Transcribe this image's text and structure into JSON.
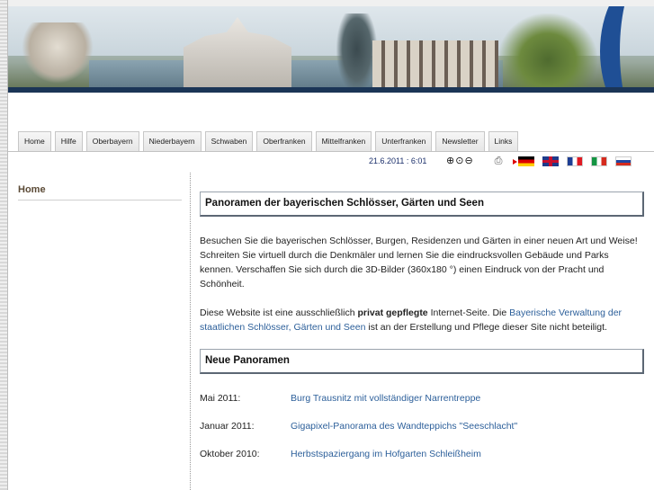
{
  "nav": {
    "tabs": [
      "Home",
      "Hilfe",
      "Oberbayern",
      "Niederbayern",
      "Schwaben",
      "Oberfranken",
      "Mittelfranken",
      "Unterfranken",
      "Newsletter",
      "Links"
    ]
  },
  "toolbar": {
    "datetime": "21.6.2011 : 6:01",
    "zoom_icons": [
      "zoom-in-icon",
      "zoom-reset-icon",
      "zoom-out-icon"
    ],
    "print_icon": "printer-icon",
    "flags": [
      "de",
      "gb",
      "fr",
      "it",
      "ru"
    ]
  },
  "sidebar": {
    "home": "Home"
  },
  "main": {
    "heading1": "Panoramen der bayerischen Schlösser, Gärten und Seen",
    "intro": "Besuchen Sie die bayerischen Schlösser, Burgen, Residenzen und Gärten in einer neuen Art und Weise! Schreiten Sie virtuell durch die Denkmäler und lernen Sie die eindrucksvollen Gebäude und Parks kennen. Verschaffen Sie sich durch die 3D-Bilder (360x180 °) einen Eindruck von der Pracht und Schönheit.",
    "private_pre": "Diese Website ist eine ausschließlich ",
    "private_bold": "privat gepflegte",
    "private_mid": " Internet-Seite. Die ",
    "private_link": "Bayerische Verwaltung der staatlichen Schlösser, Gärten und Seen",
    "private_post": " ist an der Erstellung und Pflege dieser Site nicht beteiligt.",
    "heading2": "Neue Panoramen",
    "news": [
      {
        "date": "Mai 2011:",
        "title": "Burg Trausnitz mit vollständiger Narrentreppe"
      },
      {
        "date": "Januar 2011:",
        "title": "Gigapixel-Panorama des Wandteppichs \"Seeschlacht\""
      },
      {
        "date": "Oktober 2010:",
        "title": "Herbstspaziergang im Hofgarten Schleißheim"
      }
    ]
  },
  "colors": {
    "link": "#2c5f9a",
    "banner_accent": "#1f4f95",
    "sidebar_home": "#5b4a36"
  }
}
